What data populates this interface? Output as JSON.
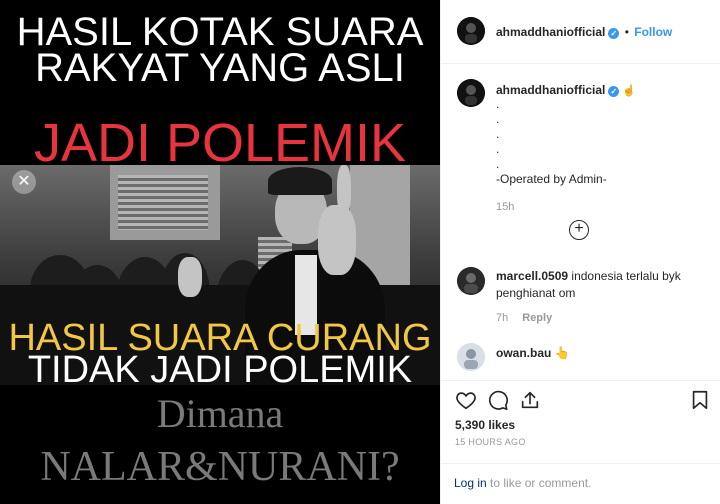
{
  "post": {
    "headline_1": "HASIL KOTAK SUARA",
    "headline_2": "RAKYAT YANG ASLI",
    "headline_3": "JADI POLEMIK",
    "headline_4": "HASIL SUARA CURANG",
    "headline_5": "TIDAK JADI POLEMIK",
    "headline_6": "Dimana",
    "headline_7": "NALAR&NURANI?",
    "colors": {
      "red": "#e8343e",
      "yellow": "#f2c744",
      "grey": "#7a7a7a"
    }
  },
  "close_icon": "✕",
  "header": {
    "username": "ahmaddhaniofficial",
    "verified_icon": "✓",
    "separator": "•",
    "follow_label": "Follow"
  },
  "caption": {
    "username": "ahmaddhaniofficial",
    "hand_icon": "☝",
    "lines": [
      ".",
      ".",
      ".",
      ".",
      ".",
      "-Operated by Admin-"
    ],
    "time": "15h"
  },
  "load_more_icon": "+",
  "comments": [
    {
      "username": "marcell.0509",
      "text": "indonesia terlalu byk penghianat om",
      "time": "7h",
      "reply_label": "Reply"
    },
    {
      "username": "owan.bau",
      "text": "👆"
    }
  ],
  "actions": {
    "like_icon": "heart-icon",
    "comment_icon": "comment-icon",
    "share_icon": "share-icon",
    "save_icon": "bookmark-icon"
  },
  "likes": "5,390 likes",
  "timestamp": "15 HOURS AGO",
  "login": {
    "link_label": "Log in",
    "rest": " to like or comment."
  }
}
